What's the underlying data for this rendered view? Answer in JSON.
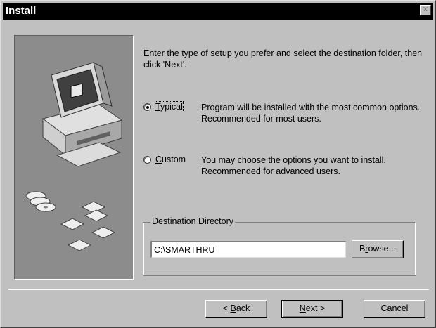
{
  "window": {
    "title": "Install",
    "close_glyph": "✕"
  },
  "intro_text": "Enter the type of setup you prefer and select the destination folder, then click 'Next'.",
  "setup_options": [
    {
      "label_accel": "T",
      "label_rest": "ypical",
      "selected": true,
      "description": "Program will be installed with the most common options. Recommended for most users."
    },
    {
      "label_accel": "C",
      "label_rest": "ustom",
      "selected": false,
      "description": "You may choose the options you want to install. Recommended for advanced users."
    }
  ],
  "destination": {
    "legend": "Destination Directory",
    "path": "C:\\SMARTHRU",
    "browse_accel": "r",
    "browse_pre": "B",
    "browse_post": "owse..."
  },
  "buttons": {
    "back_pre": "< ",
    "back_accel": "B",
    "back_post": "ack",
    "next_accel": "N",
    "next_post": "ext >",
    "cancel": "Cancel"
  },
  "icons": [
    "computer-icon",
    "cd-disc-icon",
    "floppy-disk-icon"
  ]
}
